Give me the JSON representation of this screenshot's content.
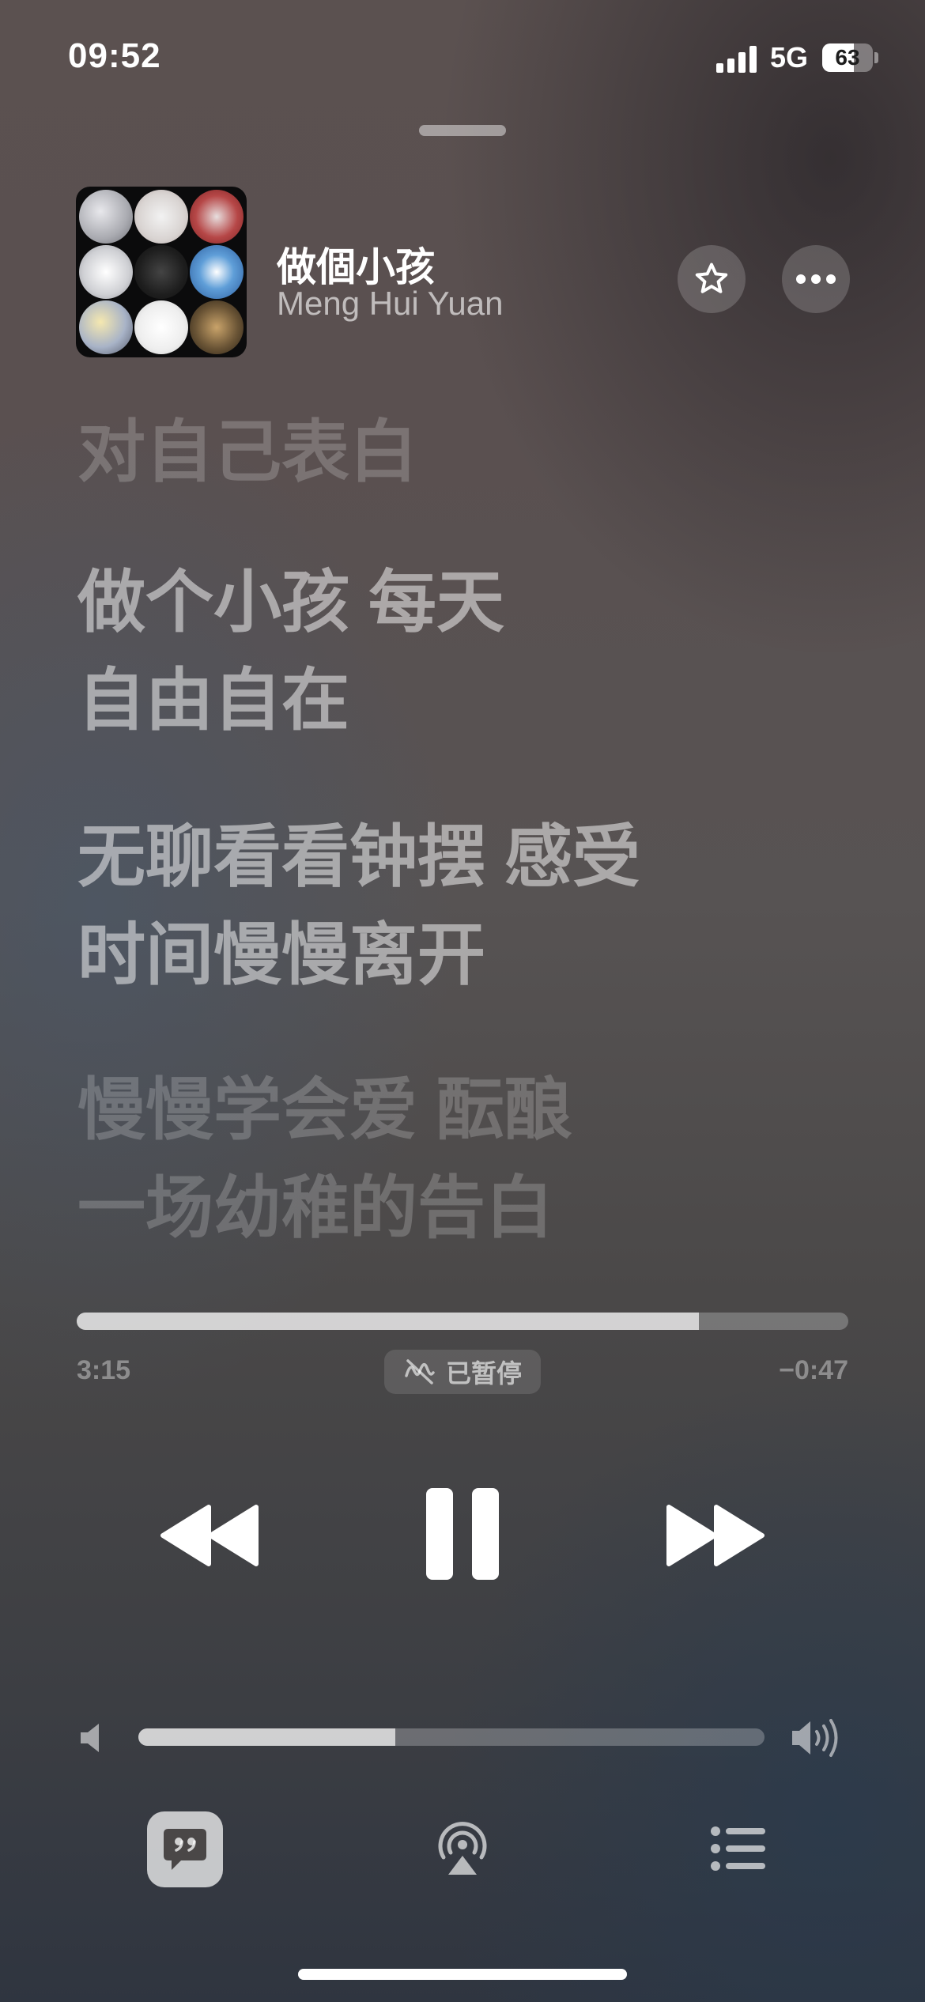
{
  "status_bar": {
    "time": "09:52",
    "network": "5G",
    "battery": "63",
    "battery_level": 0.63,
    "icons": [
      "signal-icon",
      "battery-icon"
    ]
  },
  "now_playing": {
    "title": "做個小孩",
    "artist": "Meng Hui Yuan",
    "artwork_icon": "album-artwork",
    "actions": [
      "star-icon",
      "ellipsis-icon"
    ]
  },
  "lyrics": [
    {
      "lines": [
        "对自己表白"
      ],
      "state": "past"
    },
    {
      "lines": [
        "做个小孩 每天",
        "自由自在"
      ],
      "state": "current"
    },
    {
      "lines": [
        "无聊看看钟摆 感受",
        "时间慢慢离开"
      ],
      "state": "current"
    },
    {
      "lines": [
        "慢慢学会爱 酝酿",
        "一场幼稚的告白"
      ],
      "state": "upcoming"
    }
  ],
  "playback": {
    "elapsed": "3:15",
    "remaining": "−0:47",
    "progress_fraction": 0.806,
    "status_label": "已暂停",
    "status_icon": "lossless-off-icon"
  },
  "controls": {
    "icons": [
      "rewind-icon",
      "pause-icon",
      "fast-forward-icon"
    ]
  },
  "volume": {
    "level_fraction": 0.41,
    "icons": [
      "speaker-low-icon",
      "speaker-high-icon"
    ]
  },
  "bottom_bar": {
    "icons": [
      "lyrics-quote-icon",
      "airplay-icon",
      "queue-list-icon"
    ]
  },
  "colors": {
    "text_primary": "#ffffff",
    "background_top": "#5b5150",
    "background_bottom": "#2f3540"
  }
}
